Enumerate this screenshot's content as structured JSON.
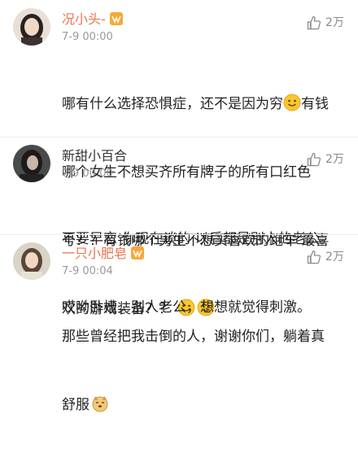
{
  "comments": [
    {
      "username": "况小头-",
      "timestamp": "7-9 00:00",
      "likes": "2万",
      "lines": [
        [
          "哪有什么选择恐惧症，还不是因为穷",
          "",
          "有钱"
        ],
        [
          "哪个女生不想买齐所有牌子的所有口红色"
        ],
        [
          "号？？有钱哪个男生不想买喜欢的跑车 最喜"
        ],
        [
          "欢的游戏装备？？"
        ]
      ]
    },
    {
      "username": "新甜小百合",
      "timestamp": "7-9 00:00",
      "likes": "2万",
      "lines": [
        [
          "不要早恋 你现在谈的 以后都是别人的老公。"
        ],
        [
          "哎呦卧槽，别人老公，想想就觉得刺激。"
        ]
      ]
    },
    {
      "username": "一只小肥皂",
      "timestamp": "7-9 00:04",
      "likes": "2万",
      "lines": [
        [
          "那些曾经把我击倒的人，谢谢你们，躺着真"
        ],
        [
          "舒服"
        ]
      ]
    }
  ],
  "colors": {
    "vip_name": "#eb7350",
    "regular_name": "#333333",
    "meta": "#999999",
    "emoji_yellow": "#f8c72c"
  },
  "icons": [
    "thumbs-up-icon",
    "vip-badge-icon",
    "smiley-emoji",
    "dog-emoji"
  ]
}
